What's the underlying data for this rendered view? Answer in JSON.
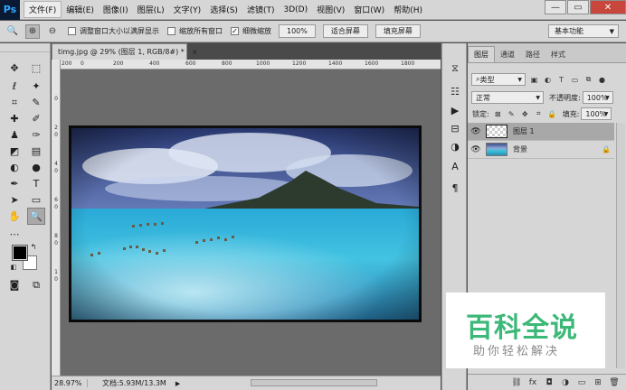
{
  "app": {
    "logo": "Ps",
    "menu": [
      "文件(F)",
      "编辑(E)",
      "图像(I)",
      "图层(L)",
      "文字(Y)",
      "选择(S)",
      "滤镜(T)",
      "3D(D)",
      "视图(V)",
      "窗口(W)",
      "帮助(H)"
    ],
    "window_controls": {
      "minimize": "—",
      "restore": "▭",
      "close": "✕"
    }
  },
  "options_bar": {
    "resize_windows_label": "调整窗口大小以满屏显示",
    "zoom_all_windows_label": "缩放所有窗口",
    "scrubby_zoom_label": "细微缩放",
    "scrubby_zoom_checked": true,
    "zoom_100": "100%",
    "fit_screen": "适合屏幕",
    "fill_screen": "填充屏幕",
    "workspace": "基本功能"
  },
  "document": {
    "tab_title": "timg.jpg @ 29% (图层 1, RGB/8#) *",
    "tab_close": "×",
    "ruler_top_labels": [
      "200",
      "0",
      "200",
      "400",
      "600",
      "800",
      "1000",
      "1200",
      "1400",
      "1600",
      "1800"
    ],
    "ruler_left_labels": [
      "0",
      "2",
      "0",
      "4",
      "0",
      "6",
      "0",
      "8",
      "0",
      "1",
      "0"
    ]
  },
  "status": {
    "zoom": "28.97%",
    "doc_info": "文档:5.93M/13.3M",
    "arrow": "▶"
  },
  "layers_panel": {
    "tabs": [
      "图层",
      "通道",
      "路径",
      "样式"
    ],
    "active_tab": "图层",
    "filter_kind": "类型",
    "blend_mode": "正常",
    "opacity_label": "不透明度:",
    "opacity_value": "100%",
    "lock_label": "锁定:",
    "fill_label": "填充:",
    "fill_value": "100%",
    "layers": [
      {
        "name": "图层 1",
        "selected": true,
        "locked": false
      },
      {
        "name": "背景",
        "selected": false,
        "locked": true
      }
    ]
  },
  "watermark": {
    "title": "百科全说",
    "subtitle": "助你轻松解决"
  },
  "colors": {
    "accent_green": "#3cb878",
    "foreground_color": "#000000",
    "background_color": "#ffffff"
  }
}
